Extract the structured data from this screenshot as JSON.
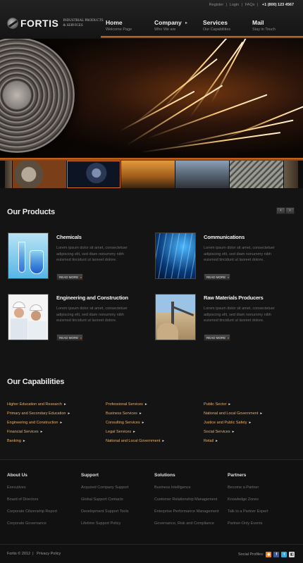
{
  "top_links": {
    "register": "Register",
    "sep1": "|",
    "login": "Login",
    "sep2": "|",
    "faqs": "FAQs",
    "sep3": "|",
    "phone": "+1 (800) 123 4567"
  },
  "brand": {
    "name": "FORTIS",
    "tagline": "INDUSTRIAL PRODUCTS & SERVICES"
  },
  "nav": [
    {
      "title": "Home",
      "sub": "Welcome Page"
    },
    {
      "title": "Company",
      "sub": "Who We are"
    },
    {
      "title": "Services",
      "sub": "Our Capabilities"
    },
    {
      "title": "Mail",
      "sub": "Stay in Touch"
    }
  ],
  "products": {
    "title": "Our Products",
    "items": [
      {
        "title": "Chemicals",
        "text": "Lorem ipsum dolor sit amet, consectetuer adipiscing elit, sed diam nonummy nibh euismod tincidunt ut laoreet dolore.",
        "button": "READ MORE"
      },
      {
        "title": "Communications",
        "text": "Lorem ipsum dolor sit amet, consectetuer adipiscing elit, sed diam nonummy nibh euismod tincidunt ut laoreet dolore.",
        "button": "READ MORE"
      },
      {
        "title": "Engineering and Construction",
        "text": "Lorem ipsum dolor sit amet, consectetuer adipiscing elit, sed diam nonummy nibh euismod tincidunt ut laoreet dolore.",
        "button": "READ MORE"
      },
      {
        "title": "Raw Materials Producers",
        "text": "Lorem ipsum dolor sit amet, consectetuer adipiscing elit, sed diam nonummy nibh euismod tincidunt ut laoreet dolore.",
        "button": "READ MORE"
      }
    ]
  },
  "capabilities": {
    "title": "Our Capabilities",
    "col1": [
      "Higher Education and Research",
      "Primary and Secondary Education",
      "Engineering and Construction",
      "Financial Services",
      "Banking"
    ],
    "col2": [
      "Professional Services",
      "Business Services",
      "Consulting Services",
      "Legal Services",
      "National and Local Government"
    ],
    "col3": [
      "Public Sector",
      "National and Local Government",
      "Justice and Public Safety",
      "Social Services",
      "Retail"
    ]
  },
  "footer": {
    "about": {
      "title": "About Us",
      "links": [
        "Executives",
        "Board of Directors",
        "Corporate Citizenship Report",
        "Corporate Governance"
      ]
    },
    "support": {
      "title": "Support",
      "links": [
        "Acquired Company Support",
        "Global Support Contacts",
        "Development Support Tools",
        "Lifetime Support Policy"
      ]
    },
    "solutions": {
      "title": "Solutions",
      "links": [
        "Business Intelligence",
        "Customer Relationship Management",
        "Enterprise Performance Management",
        "Governance, Risk and Compliance"
      ]
    },
    "partners": {
      "title": "Partners",
      "links": [
        "Become a Partner",
        "Knowledge Zones",
        "Talk to a Partner Expert",
        "Partner-Only Events"
      ]
    },
    "copyright": "Fortis © 2012",
    "privacy": "Privacy Policy",
    "social_label": "Social Profiles:"
  },
  "colors": {
    "accent": "#d36f1f",
    "link": "#e7b06a",
    "background": "#141414"
  }
}
